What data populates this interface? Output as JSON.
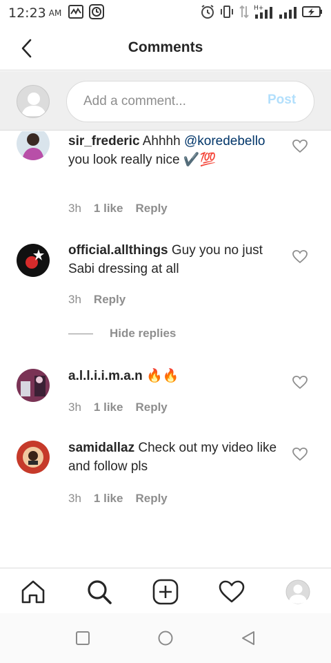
{
  "status_bar": {
    "time": "12:23",
    "ampm": "AM"
  },
  "header": {
    "title": "Comments"
  },
  "comment_box": {
    "placeholder": "Add a comment...",
    "post_label": "Post"
  },
  "comments": [
    {
      "username": "sir_frederic",
      "text_before": " Ahhhh ",
      "mention": "@koredebello",
      "text_after": " you look really nice ✔️💯",
      "time": "3h",
      "likes": "1 like",
      "reply_label": "Reply"
    },
    {
      "username": "official.allthings",
      "text": " Guy you no just Sabi dressing at all",
      "time": "3h",
      "reply_label": "Reply"
    },
    {
      "username": "a.l.l.i.i.m.a.n",
      "text": " 🔥🔥",
      "time": "3h",
      "likes": "1 like",
      "reply_label": "Reply"
    },
    {
      "username": "samidallaz",
      "text": " Check out my video like and follow pls",
      "time": "3h",
      "likes": "1 like",
      "reply_label": "Reply"
    }
  ],
  "hide_replies_label": "Hide replies",
  "colors": {
    "link": "#003569",
    "post_disabled": "#b2dffc",
    "muted": "#8e8e8e"
  }
}
